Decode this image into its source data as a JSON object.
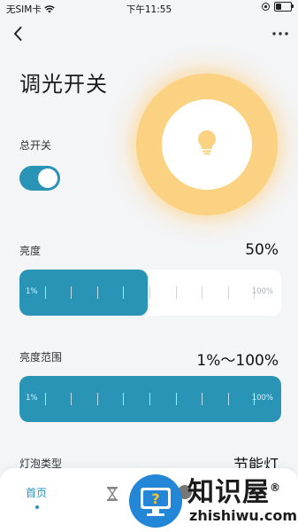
{
  "status": {
    "carrier": "无SIM卡",
    "time": "下午11:55"
  },
  "page": {
    "title": "调光开关"
  },
  "power_switch": {
    "label": "总开关",
    "on": true
  },
  "brightness": {
    "label": "亮度",
    "value": "50%",
    "min_label": "1%",
    "max_label": "100%",
    "fill_fraction": 0.49
  },
  "brightness_range": {
    "label": "亮度范围",
    "value": "1%～100%",
    "min_label": "1%",
    "max_label": "100%",
    "fill_fraction": 1.0
  },
  "bulb_type": {
    "label": "灯泡类型",
    "value": "节能灯"
  },
  "tabbar": {
    "tabs": [
      {
        "label": "首页",
        "active": true
      }
    ]
  },
  "watermark": {
    "brand": "知识屋",
    "domain": "zhishiwu.com",
    "mark": "®"
  },
  "colors": {
    "accent": "#2a94b7",
    "lamp": "#fbd281",
    "background": "#f4f5f7"
  },
  "icons": [
    "back-icon",
    "more-icon",
    "bulb-icon",
    "wifi-icon",
    "battery-icon",
    "timer-icon",
    "settings-icon"
  ]
}
